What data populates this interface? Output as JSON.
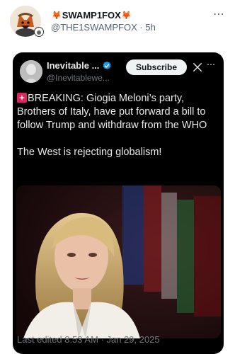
{
  "outer_post": {
    "display_name": "SWAMP1FOX",
    "name_emoji": "🦊",
    "handle": "@THE1SWAMPFOX",
    "timestamp": "5h",
    "separator": "·",
    "more_icon": "⋯"
  },
  "quoted_post": {
    "display_name": "Inevitable ...",
    "handle": "@Inevitablewe...",
    "subscribe_label": "Subscribe",
    "more_icon": "⋯",
    "line1": "BREAKING: Giogia Meloni’s party, Brothers of Italy, have put forward a bill to follow Trump and withdraw from the WHO",
    "line2": "The West is rejecting globalism!",
    "last_edited": "Last edited 8:53 AM · Jan 29, 2025"
  },
  "colors": {
    "card_bg": "#000000",
    "text_primary": "#e7e9ea",
    "text_secondary": "#71767b",
    "verified": "#1d9bf0",
    "siren": "#e0245e"
  }
}
